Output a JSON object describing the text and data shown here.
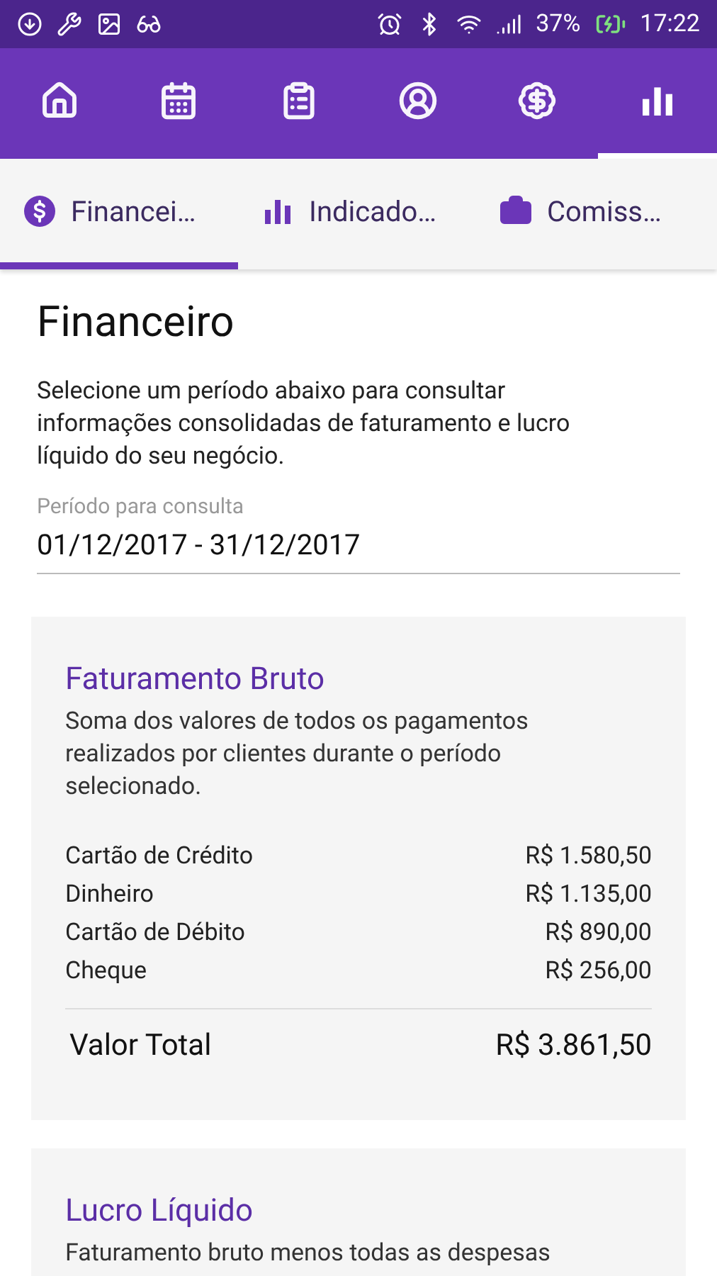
{
  "status_bar": {
    "battery": "37%",
    "time": "17:22"
  },
  "nav_tabs": [
    {
      "kind": "home",
      "selected": false
    },
    {
      "kind": "calendar",
      "selected": false
    },
    {
      "kind": "clipboard",
      "selected": false
    },
    {
      "kind": "account",
      "selected": false
    },
    {
      "kind": "money-off",
      "selected": false
    },
    {
      "kind": "chart",
      "selected": true
    }
  ],
  "sub_tabs": [
    {
      "kind": "dollar",
      "label": "Financei…",
      "selected": true
    },
    {
      "kind": "chart",
      "label": "Indicado…",
      "selected": false
    },
    {
      "kind": "briefcase",
      "label": "Comiss…",
      "selected": false
    }
  ],
  "page": {
    "title": "Financeiro",
    "description": "Selecione um período abaixo para consultar informações consolidadas de faturamento e lucro líquido do seu negócio.",
    "period_field": {
      "label": "Período para consulta",
      "value": "01/12/2017 - 31/12/2017"
    }
  },
  "cards": [
    {
      "title": "Faturamento Bruto",
      "description": "Soma dos valores de todos os pagamentos realizados por clientes durante o período selecionado.",
      "rows": [
        {
          "label": "Cartão de Crédito",
          "value": "R$ 1.580,50"
        },
        {
          "label": "Dinheiro",
          "value": "R$ 1.135,00"
        },
        {
          "label": "Cartão de Débito",
          "value": "R$ 890,00"
        },
        {
          "label": "Cheque",
          "value": "R$ 256,00"
        }
      ],
      "total": {
        "label": "Valor Total",
        "value": "R$ 3.861,50"
      }
    },
    {
      "title": "Lucro Líquido",
      "description": "Faturamento bruto menos todas as despesas"
    }
  ]
}
